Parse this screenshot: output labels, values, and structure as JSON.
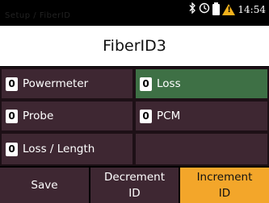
{
  "statusbar": {
    "path": "Setup / FiberID",
    "bluetooth_icon": "bluetooth-icon",
    "clock_icon": "clock-icon",
    "battery_icon": "battery-icon",
    "warning_icon": "warning-icon",
    "time": "14:54",
    "warning_color": "#f2b21d"
  },
  "title": "FiberID3",
  "tiles": [
    {
      "value": "0",
      "label": "Powermeter",
      "active": false
    },
    {
      "value": "0",
      "label": "Loss",
      "active": true
    },
    {
      "value": "0",
      "label": "Probe",
      "active": false
    },
    {
      "value": "0",
      "label": "PCM",
      "active": false
    },
    {
      "value": "0",
      "label": "Loss / Length",
      "active": false
    }
  ],
  "buttons": {
    "save": "Save",
    "decrement_line1": "Decrement",
    "decrement_line2": "ID",
    "increment_line1": "Increment",
    "increment_line2": "ID"
  },
  "colors": {
    "tile_bg": "#3e2732",
    "tile_active": "#3e7045",
    "primary_button": "#f3a62a"
  }
}
